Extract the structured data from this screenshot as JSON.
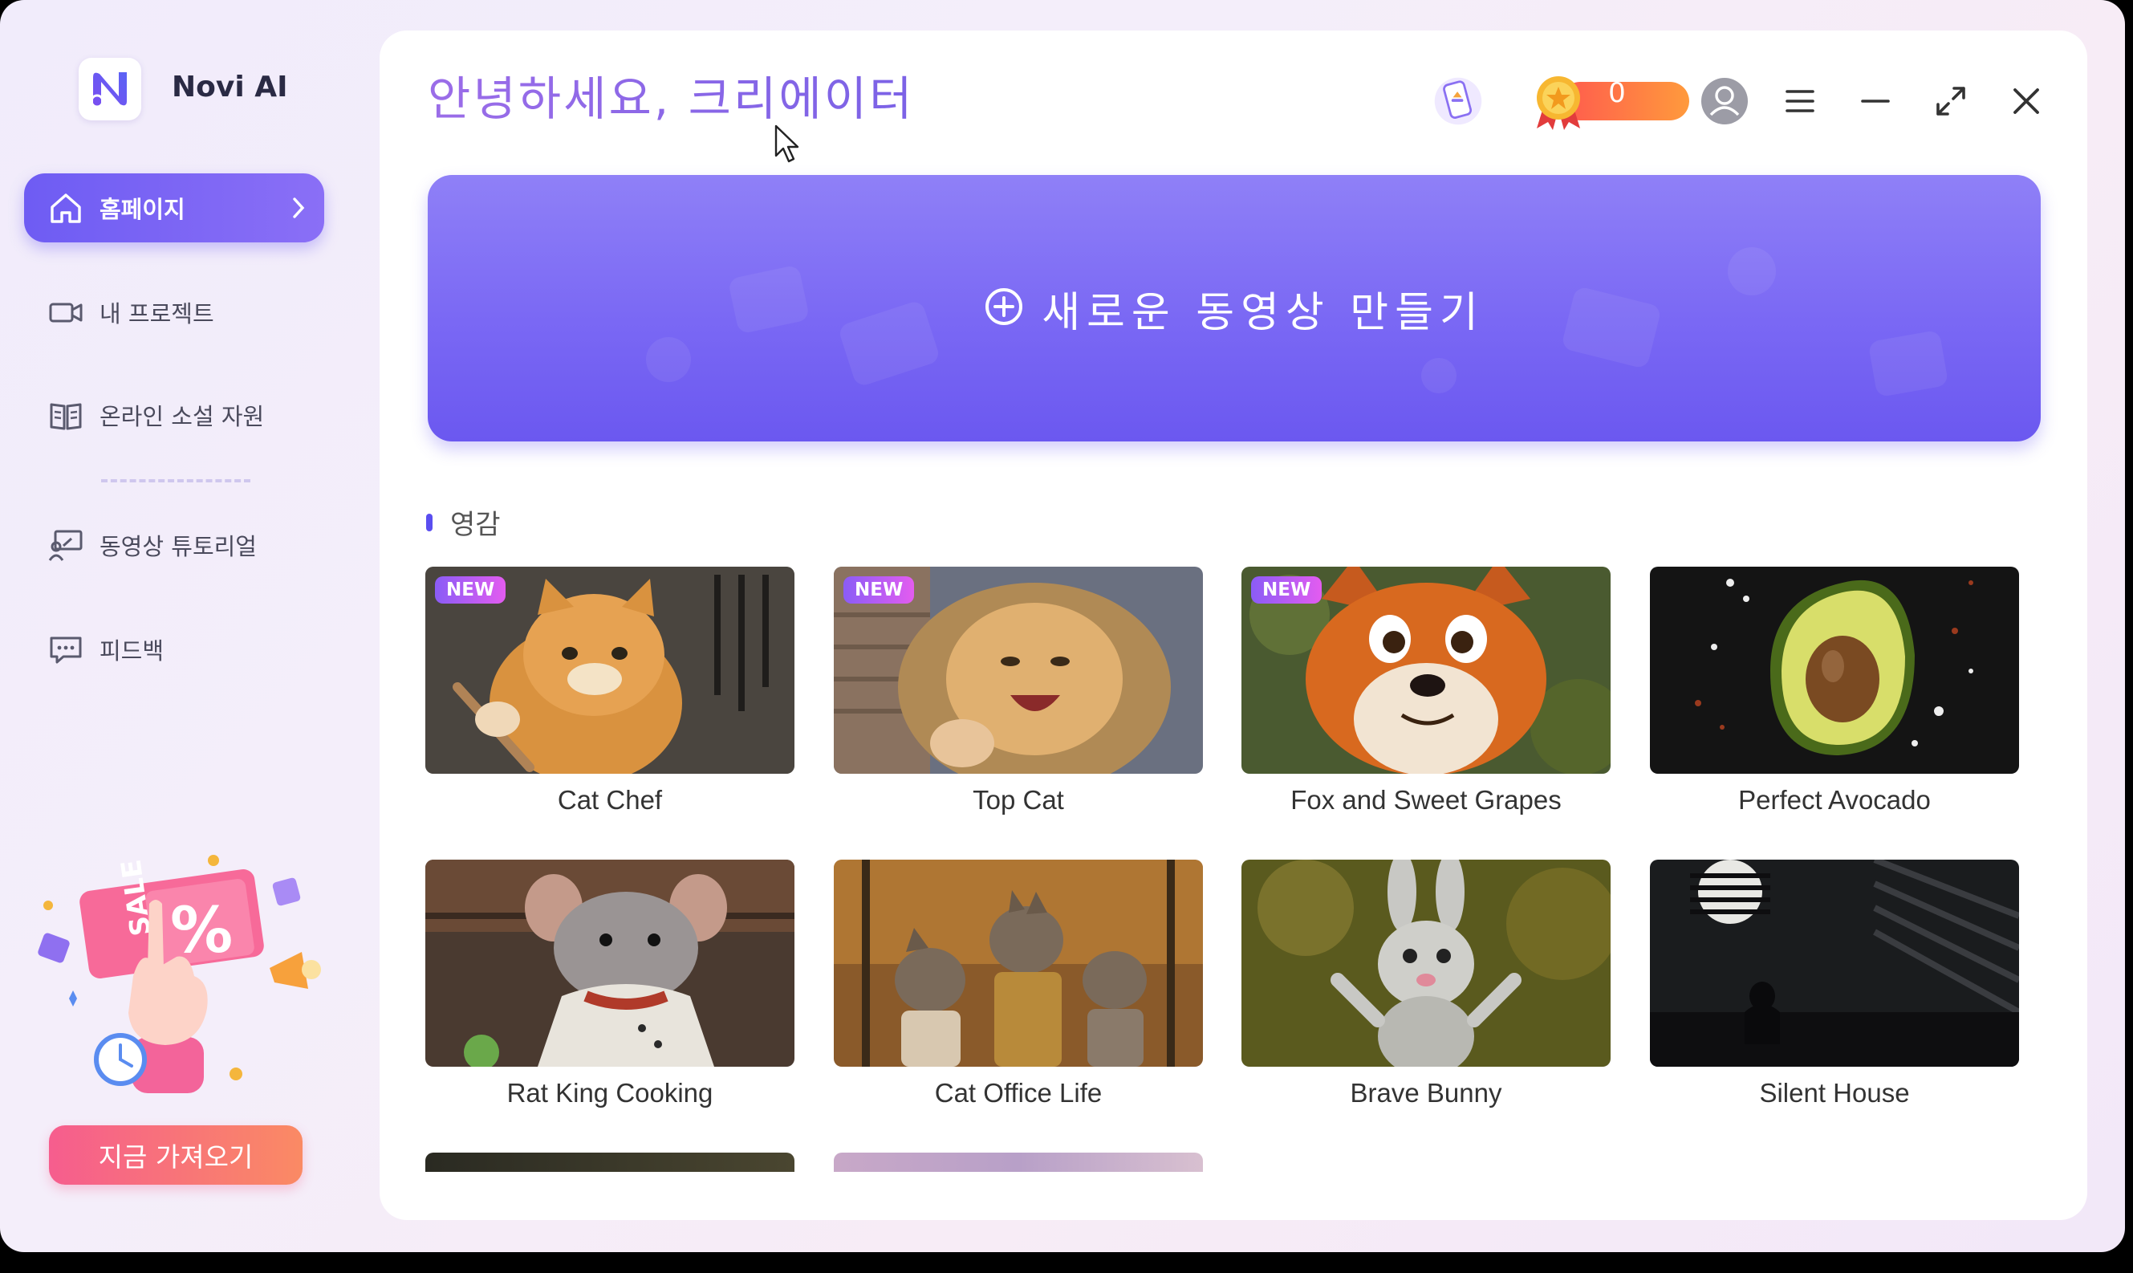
{
  "app": {
    "name": "Novi AI"
  },
  "sidebar": {
    "items": [
      {
        "label": "홈페이지",
        "icon": "home-icon",
        "active": true
      },
      {
        "label": "내 프로젝트",
        "icon": "video-camera-icon",
        "active": false
      },
      {
        "label": "온라인 소설 자원",
        "icon": "book-icon",
        "active": false
      },
      {
        "label": "동영상 튜토리얼",
        "icon": "tutorial-icon",
        "active": false
      },
      {
        "label": "피드백",
        "icon": "feedback-icon",
        "active": false
      }
    ],
    "promo": {
      "sale_text": "SALE",
      "percent": "%",
      "button_label": "지금 가져오기"
    }
  },
  "header": {
    "greeting": "안녕하세요, 크리에이터",
    "coins": "0"
  },
  "create": {
    "label": "새로운 동영상 만들기"
  },
  "inspiration": {
    "title": "영감",
    "cards": [
      {
        "title": "Cat Chef",
        "badge": "NEW"
      },
      {
        "title": "Top Cat",
        "badge": "NEW"
      },
      {
        "title": "Fox and Sweet Grapes",
        "badge": "NEW"
      },
      {
        "title": "Perfect Avocado",
        "badge": ""
      },
      {
        "title": "Rat King Cooking",
        "badge": ""
      },
      {
        "title": "Cat Office Life",
        "badge": ""
      },
      {
        "title": "Brave Bunny",
        "badge": ""
      },
      {
        "title": "Silent House",
        "badge": ""
      }
    ]
  },
  "colors": {
    "accent": "#6e5cf3",
    "promo_button": "#f65d8e",
    "coin": "#ff7a3c"
  }
}
